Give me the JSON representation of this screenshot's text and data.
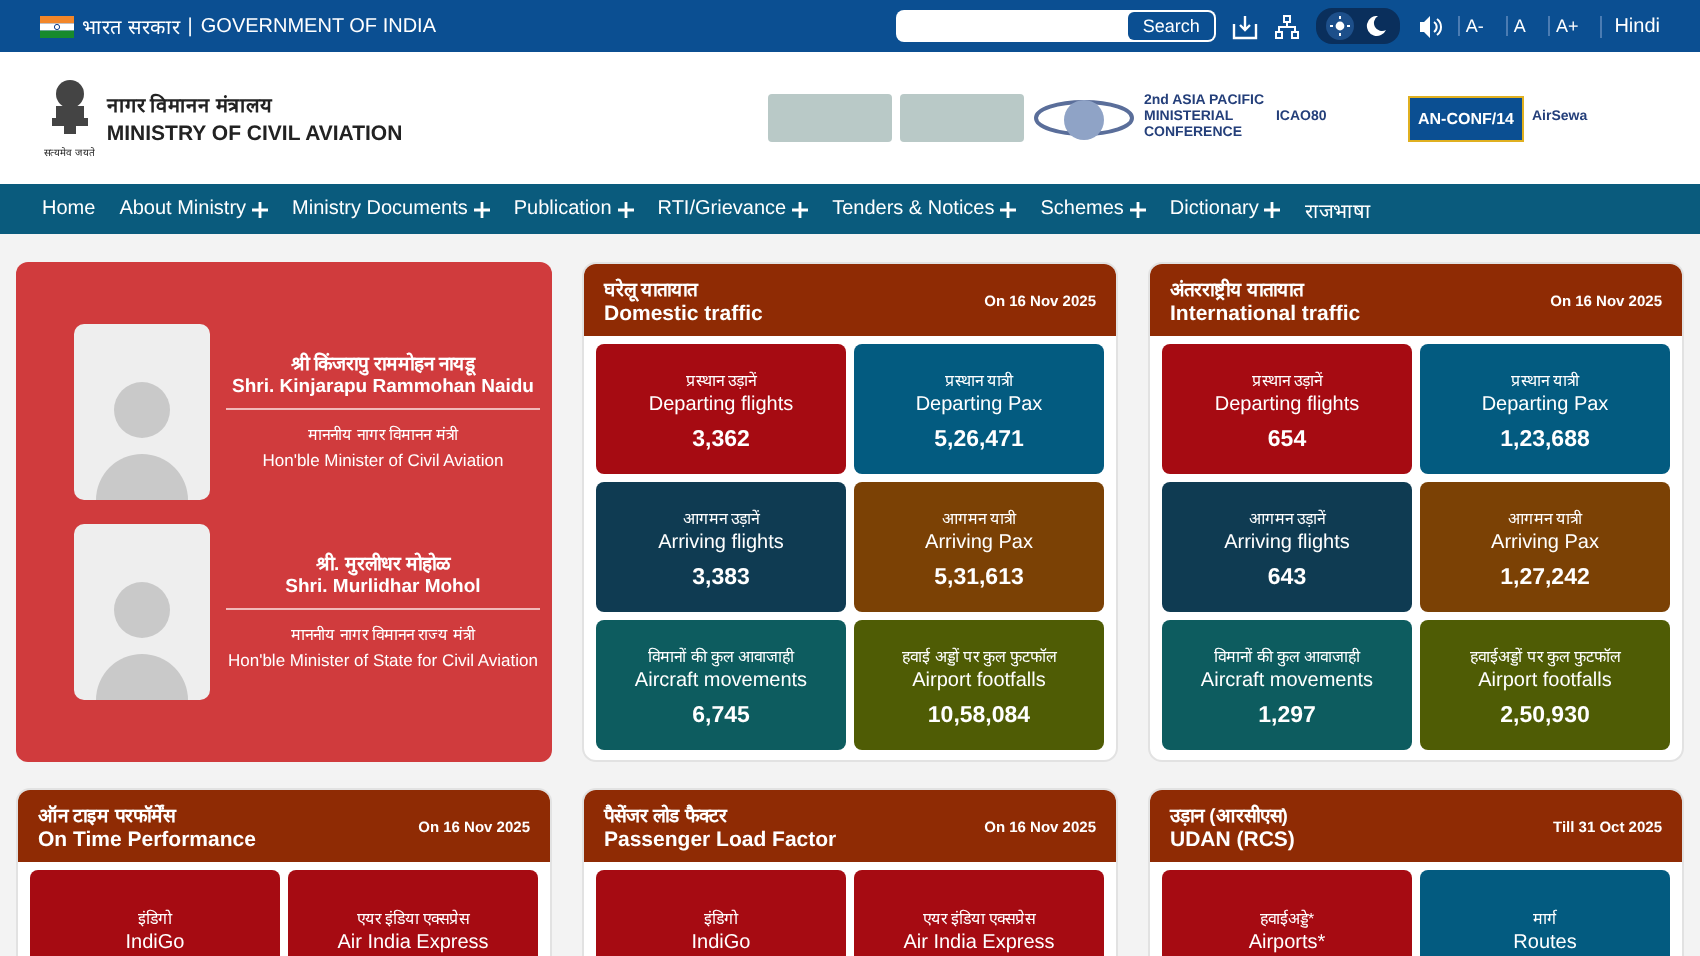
{
  "top_bar": {
    "gov_hindi": "भारत सरकार",
    "separator": "|",
    "gov_english": "GOVERNMENT OF INDIA",
    "search": {
      "button": "Search"
    },
    "theme": [
      {
        "kind": "light",
        "selected": true
      },
      {
        "kind": "dark",
        "selected": false
      }
    ],
    "font_sizes": [
      "A-",
      "A",
      "A+"
    ],
    "language": "Hindi"
  },
  "header": {
    "ministry_hindi": "नागर विमानन मंत्रालय",
    "ministry_english": "MINISTRY OF CIVIL AVIATION",
    "motto": "सत्यमेव जयते",
    "banner_logos": [
      {
        "kind": "photo"
      },
      {
        "kind": "photo"
      },
      {
        "kind": "emblem"
      },
      {
        "kind": "text",
        "text": "2nd ASIA PACIFIC MINISTERIAL CONFERENCE"
      },
      {
        "kind": "text",
        "text": "ICAO80"
      },
      {
        "kind": "badge",
        "text": "AN-CONF/14"
      },
      {
        "kind": "text",
        "text": "AirSewa"
      }
    ]
  },
  "nav": [
    {
      "label": "Home",
      "expandable": false
    },
    {
      "label": "About Ministry",
      "expandable": true
    },
    {
      "label": "Ministry Documents",
      "expandable": true
    },
    {
      "label": "Publication",
      "expandable": true
    },
    {
      "label": "RTI/Grievance",
      "expandable": true
    },
    {
      "label": "Tenders & Notices",
      "expandable": true
    },
    {
      "label": "Schemes",
      "expandable": true
    },
    {
      "label": "Dictionary",
      "expandable": true
    },
    {
      "label": "राजभाषा",
      "expandable": false
    }
  ],
  "ministers": [
    {
      "name_hindi": "श्री किंजरापु राममोहन नायडू",
      "name_english": "Shri. Kinjarapu Rammohan Naidu",
      "role_hindi": "माननीय नागर विमानन मंत्री",
      "role_english": "Hon'ble Minister of Civil Aviation"
    },
    {
      "name_hindi": "श्री. मुरलीधर मोहोळ",
      "name_english": "Shri. Murlidhar Mohol",
      "role_hindi": "माननीय नागर विमानन राज्य मंत्री",
      "role_english": "Hon'ble Minister of State for Civil Aviation"
    }
  ],
  "stat_cards": [
    {
      "title_hindi": "घरेलू यातायात",
      "title_english": "Domestic traffic",
      "date": "On 16 Nov 2025",
      "tiles": [
        {
          "hindi": "प्रस्थान उड़ानें",
          "english": "Departing flights",
          "value": "3,362",
          "color": "#a60b12"
        },
        {
          "hindi": "प्रस्थान यात्री",
          "english": "Departing Pax",
          "value": "5,26,471",
          "color": "#035b80"
        },
        {
          "hindi": "आगमन उड़ानें",
          "english": "Arriving flights",
          "value": "3,383",
          "color": "#0f3b52"
        },
        {
          "hindi": "आगमन यात्री",
          "english": "Arriving Pax",
          "value": "5,31,613",
          "color": "#7b4105"
        },
        {
          "hindi": "विमानों की कुल आवाजाही",
          "english": "Aircraft movements",
          "value": "6,745",
          "color": "#0d5c5f"
        },
        {
          "hindi": "हवाई अड्डों पर कुल फुटफॉल",
          "english": "Airport footfalls",
          "value": "10,58,084",
          "color": "#4f5c05"
        }
      ]
    },
    {
      "title_hindi": "अंतरराष्ट्रीय यातायात",
      "title_english": "International traffic",
      "date": "On 16 Nov 2025",
      "tiles": [
        {
          "hindi": "प्रस्थान उड़ानें",
          "english": "Departing flights",
          "value": "654",
          "color": "#a60b12"
        },
        {
          "hindi": "प्रस्थान यात्री",
          "english": "Departing Pax",
          "value": "1,23,688",
          "color": "#035b80"
        },
        {
          "hindi": "आगमन उड़ानें",
          "english": "Arriving flights",
          "value": "643",
          "color": "#0f3b52"
        },
        {
          "hindi": "आगमन यात्री",
          "english": "Arriving Pax",
          "value": "1,27,242",
          "color": "#7b4105"
        },
        {
          "hindi": "विमानों की कुल आवाजाही",
          "english": "Aircraft movements",
          "value": "1,297",
          "color": "#0d5c5f"
        },
        {
          "hindi": "हवाईअड्डों पर कुल फुटफॉल",
          "english": "Airport footfalls",
          "value": "2,50,930",
          "color": "#4f5c05"
        }
      ]
    },
    {
      "title_hindi": "ऑन टाइम परफॉर्मेंस",
      "title_english": "On Time Performance",
      "date": "On 16 Nov 2025",
      "tiles": [
        {
          "hindi": "इंडिगो",
          "english": "IndiGo",
          "color": "#a60b12"
        },
        {
          "hindi": "एयर इंडिया एक्सप्रेस",
          "english": "Air India Express",
          "color": "#a60b12"
        }
      ]
    },
    {
      "title_hindi": "पैसेंजर लोड फैक्टर",
      "title_english": "Passenger Load Factor",
      "date": "On 16 Nov 2025",
      "tiles": [
        {
          "hindi": "इंडिगो",
          "english": "IndiGo",
          "color": "#a60b12"
        },
        {
          "hindi": "एयर इंडिया एक्सप्रेस",
          "english": "Air India Express",
          "color": "#a60b12"
        }
      ]
    },
    {
      "title_hindi": "उड़ान (आरसीएस)",
      "title_english": "UDAN (RCS)",
      "date": "Till 31 Oct 2025",
      "tiles": [
        {
          "hindi": "हवाईअड्डे*",
          "english": "Airports*",
          "color": "#a60b12"
        },
        {
          "hindi": "मार्ग",
          "english": "Routes",
          "color": "#035b80"
        }
      ]
    }
  ]
}
